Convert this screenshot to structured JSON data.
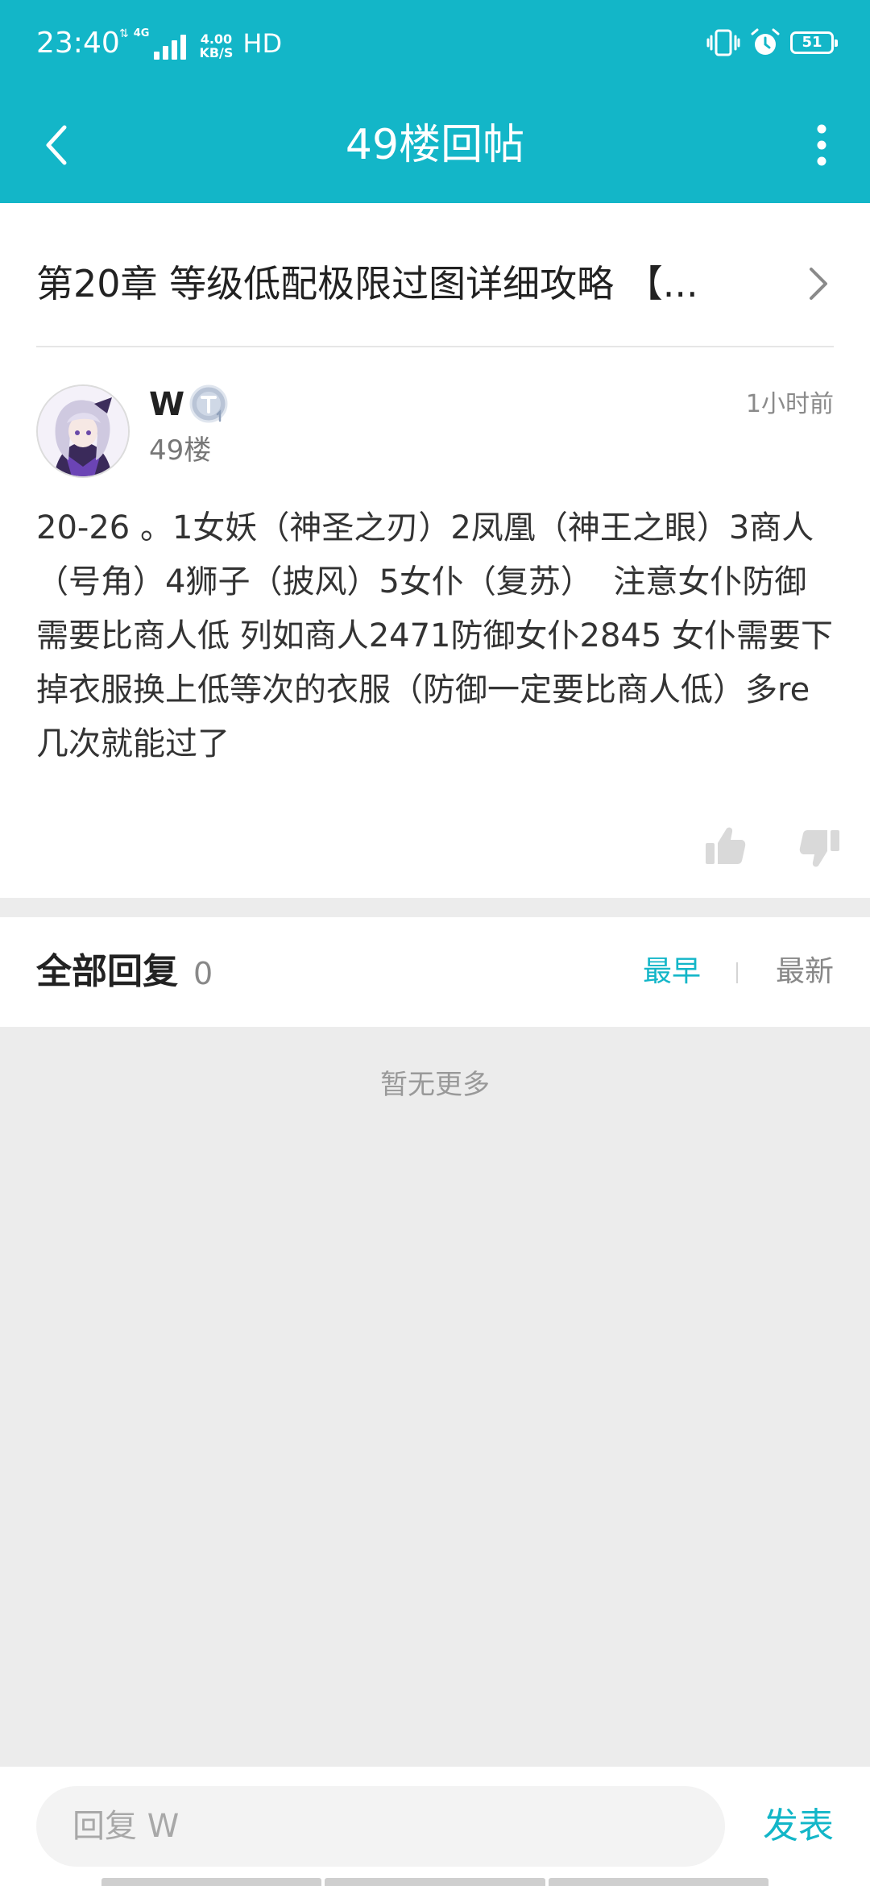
{
  "status_bar": {
    "time": "23:40",
    "network_type": "4G",
    "net_speed_value": "4.00",
    "net_speed_unit": "KB/S",
    "hd": "HD",
    "battery": "51"
  },
  "header": {
    "title": "49楼回帖"
  },
  "thread": {
    "title": "第20章 等级低配极限过图详细攻略 【..."
  },
  "post": {
    "username": "W",
    "rank_badge": "T1",
    "floor": "49楼",
    "time": "1小时前",
    "content": "20-26 。1女妖（神圣之刃）2凤凰（神王之眼）3商人（号角）4狮子（披风）5女仆（复苏）  注意女仆防御需要比商人低 列如商人2471防御女仆2845 女仆需要下掉衣服换上低等次的衣服（防御一定要比商人低）多re几次就能过了"
  },
  "replies": {
    "title": "全部回复",
    "count": "0",
    "sort_earliest": "最早",
    "sort_latest": "最新",
    "empty_text": "暂无更多"
  },
  "reply_bar": {
    "placeholder": "回复 W",
    "publish_label": "发表"
  },
  "colors": {
    "accent": "#13b6c8",
    "background": "#ececec",
    "card": "#ffffff"
  }
}
